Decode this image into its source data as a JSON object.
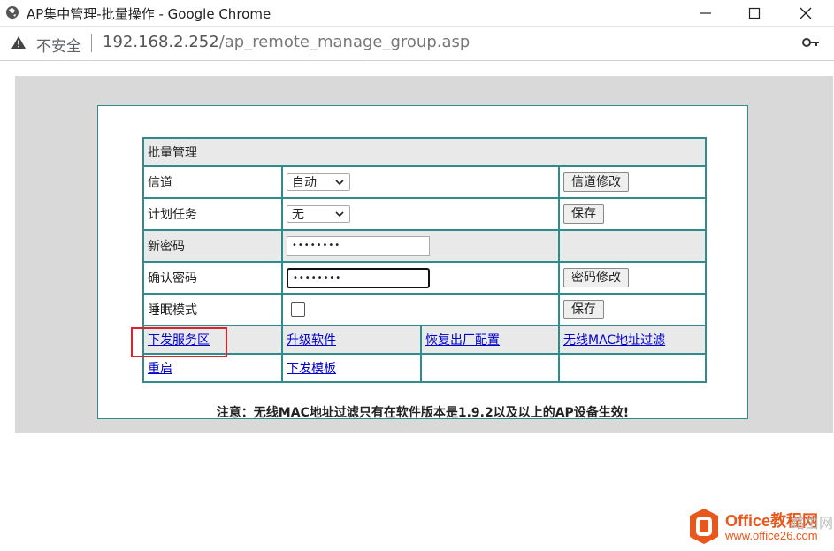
{
  "window": {
    "title": "AP集中管理-批量操作 - Google Chrome"
  },
  "address_bar": {
    "security_label": "不安全",
    "url_host": "192.168.2.252",
    "url_path": "/ap_remote_manage_group.asp"
  },
  "form": {
    "header": "批量管理",
    "rows": {
      "channel": {
        "label": "信道",
        "select_value": "自动",
        "button": "信道修改"
      },
      "schedule": {
        "label": "计划任务",
        "select_value": "无",
        "button": "保存"
      },
      "new_password": {
        "label": "新密码",
        "masked_value": "••••••••"
      },
      "confirm_password": {
        "label": "确认密码",
        "masked_value": "••••••••",
        "button": "密码修改"
      },
      "sleep_mode": {
        "label": "睡眠模式",
        "checked": false,
        "button": "保存"
      }
    },
    "links_row1": [
      "下发服务区",
      "升级软件",
      "恢复出厂配置",
      "无线MAC地址过滤"
    ],
    "links_row2": [
      "重启",
      "下发模板"
    ],
    "highlight_color": "#d9232e"
  },
  "note": "注意：无线MAC地址过滤只有在软件版本是1.9.2以及以上的AP设备生效!",
  "watermark": {
    "brand": "Office教程网",
    "site": "www.office26.com",
    "faint": "路由网"
  }
}
